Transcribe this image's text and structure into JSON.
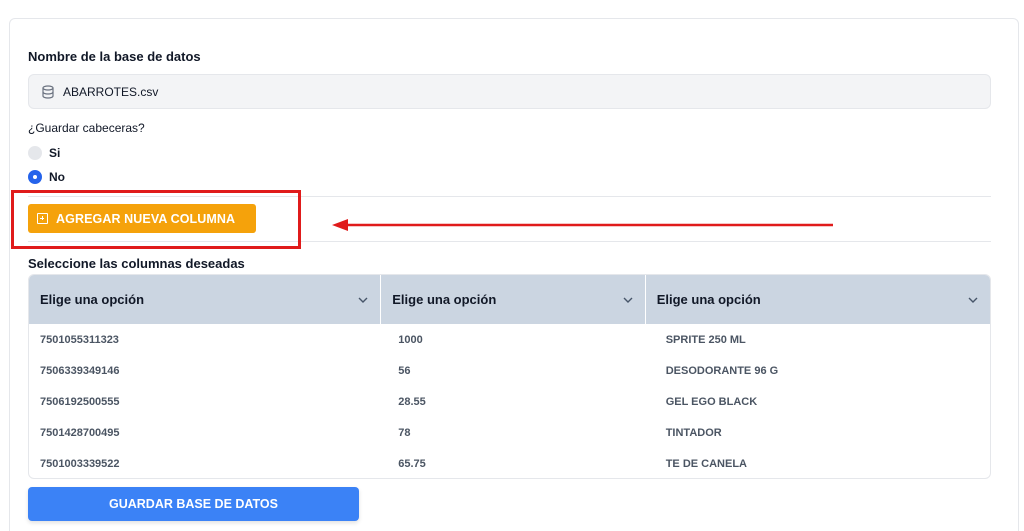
{
  "form": {
    "db_name_label": "Nombre de la base de datos",
    "db_name_value": "ABARROTES.csv",
    "headers_label": "¿Guardar cabeceras?",
    "radio_options": [
      {
        "label": "Si",
        "checked": false
      },
      {
        "label": "No",
        "checked": true
      }
    ],
    "add_column_label": "AGREGAR NUEVA COLUMNA",
    "columns_label": "Seleccione las columnas deseadas",
    "save_label": "GUARDAR BASE DE DATOS"
  },
  "table": {
    "headers": [
      "Elige una opción",
      "Elige una opción",
      "Elige una opción"
    ],
    "rows": [
      [
        "7501055311323",
        "1000",
        "SPRITE 250 ML"
      ],
      [
        "7506339349146",
        "56",
        "DESODORANTE 96 G"
      ],
      [
        "7506192500555",
        "28.55",
        "GEL EGO BLACK"
      ],
      [
        "7501428700495",
        "78",
        "TINTADOR"
      ],
      [
        "7501003339522",
        "65.75",
        "TE DE CANELA"
      ]
    ]
  },
  "annotation": {
    "highlight_color": "#e01b1b"
  },
  "colors": {
    "accent_orange": "#f5a20b",
    "primary_blue": "#3b82f6",
    "radio_blue": "#2563eb",
    "header_bg": "#cbd5e1"
  },
  "icons": {
    "db_field": "database-icon",
    "add_button": "plus-square-icon",
    "select": "chevron-down-icon"
  }
}
